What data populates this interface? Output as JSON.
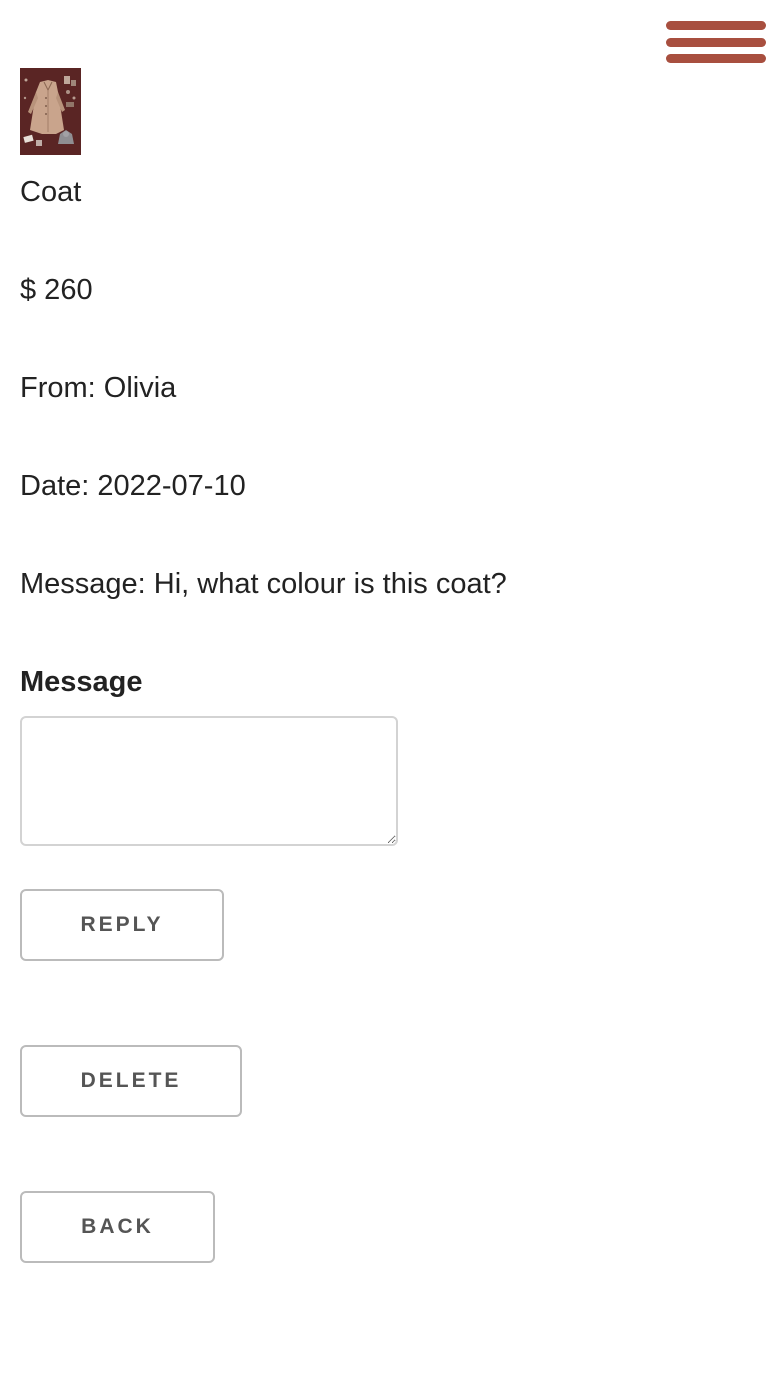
{
  "nav": {
    "menu_icon": "hamburger-menu-icon",
    "accent_color": "#a84f3f"
  },
  "item": {
    "image": "coat-product-thumbnail",
    "title": "Coat",
    "price": "$ 260",
    "from": "From: Olivia",
    "date": "Date: 2022-07-10",
    "message": "Message: Hi, what colour is this coat?"
  },
  "reply_form": {
    "label": "Message",
    "value": "",
    "placeholder": ""
  },
  "actions": {
    "reply_label": "REPLY",
    "delete_label": "DELETE",
    "back_label": "BACK"
  }
}
